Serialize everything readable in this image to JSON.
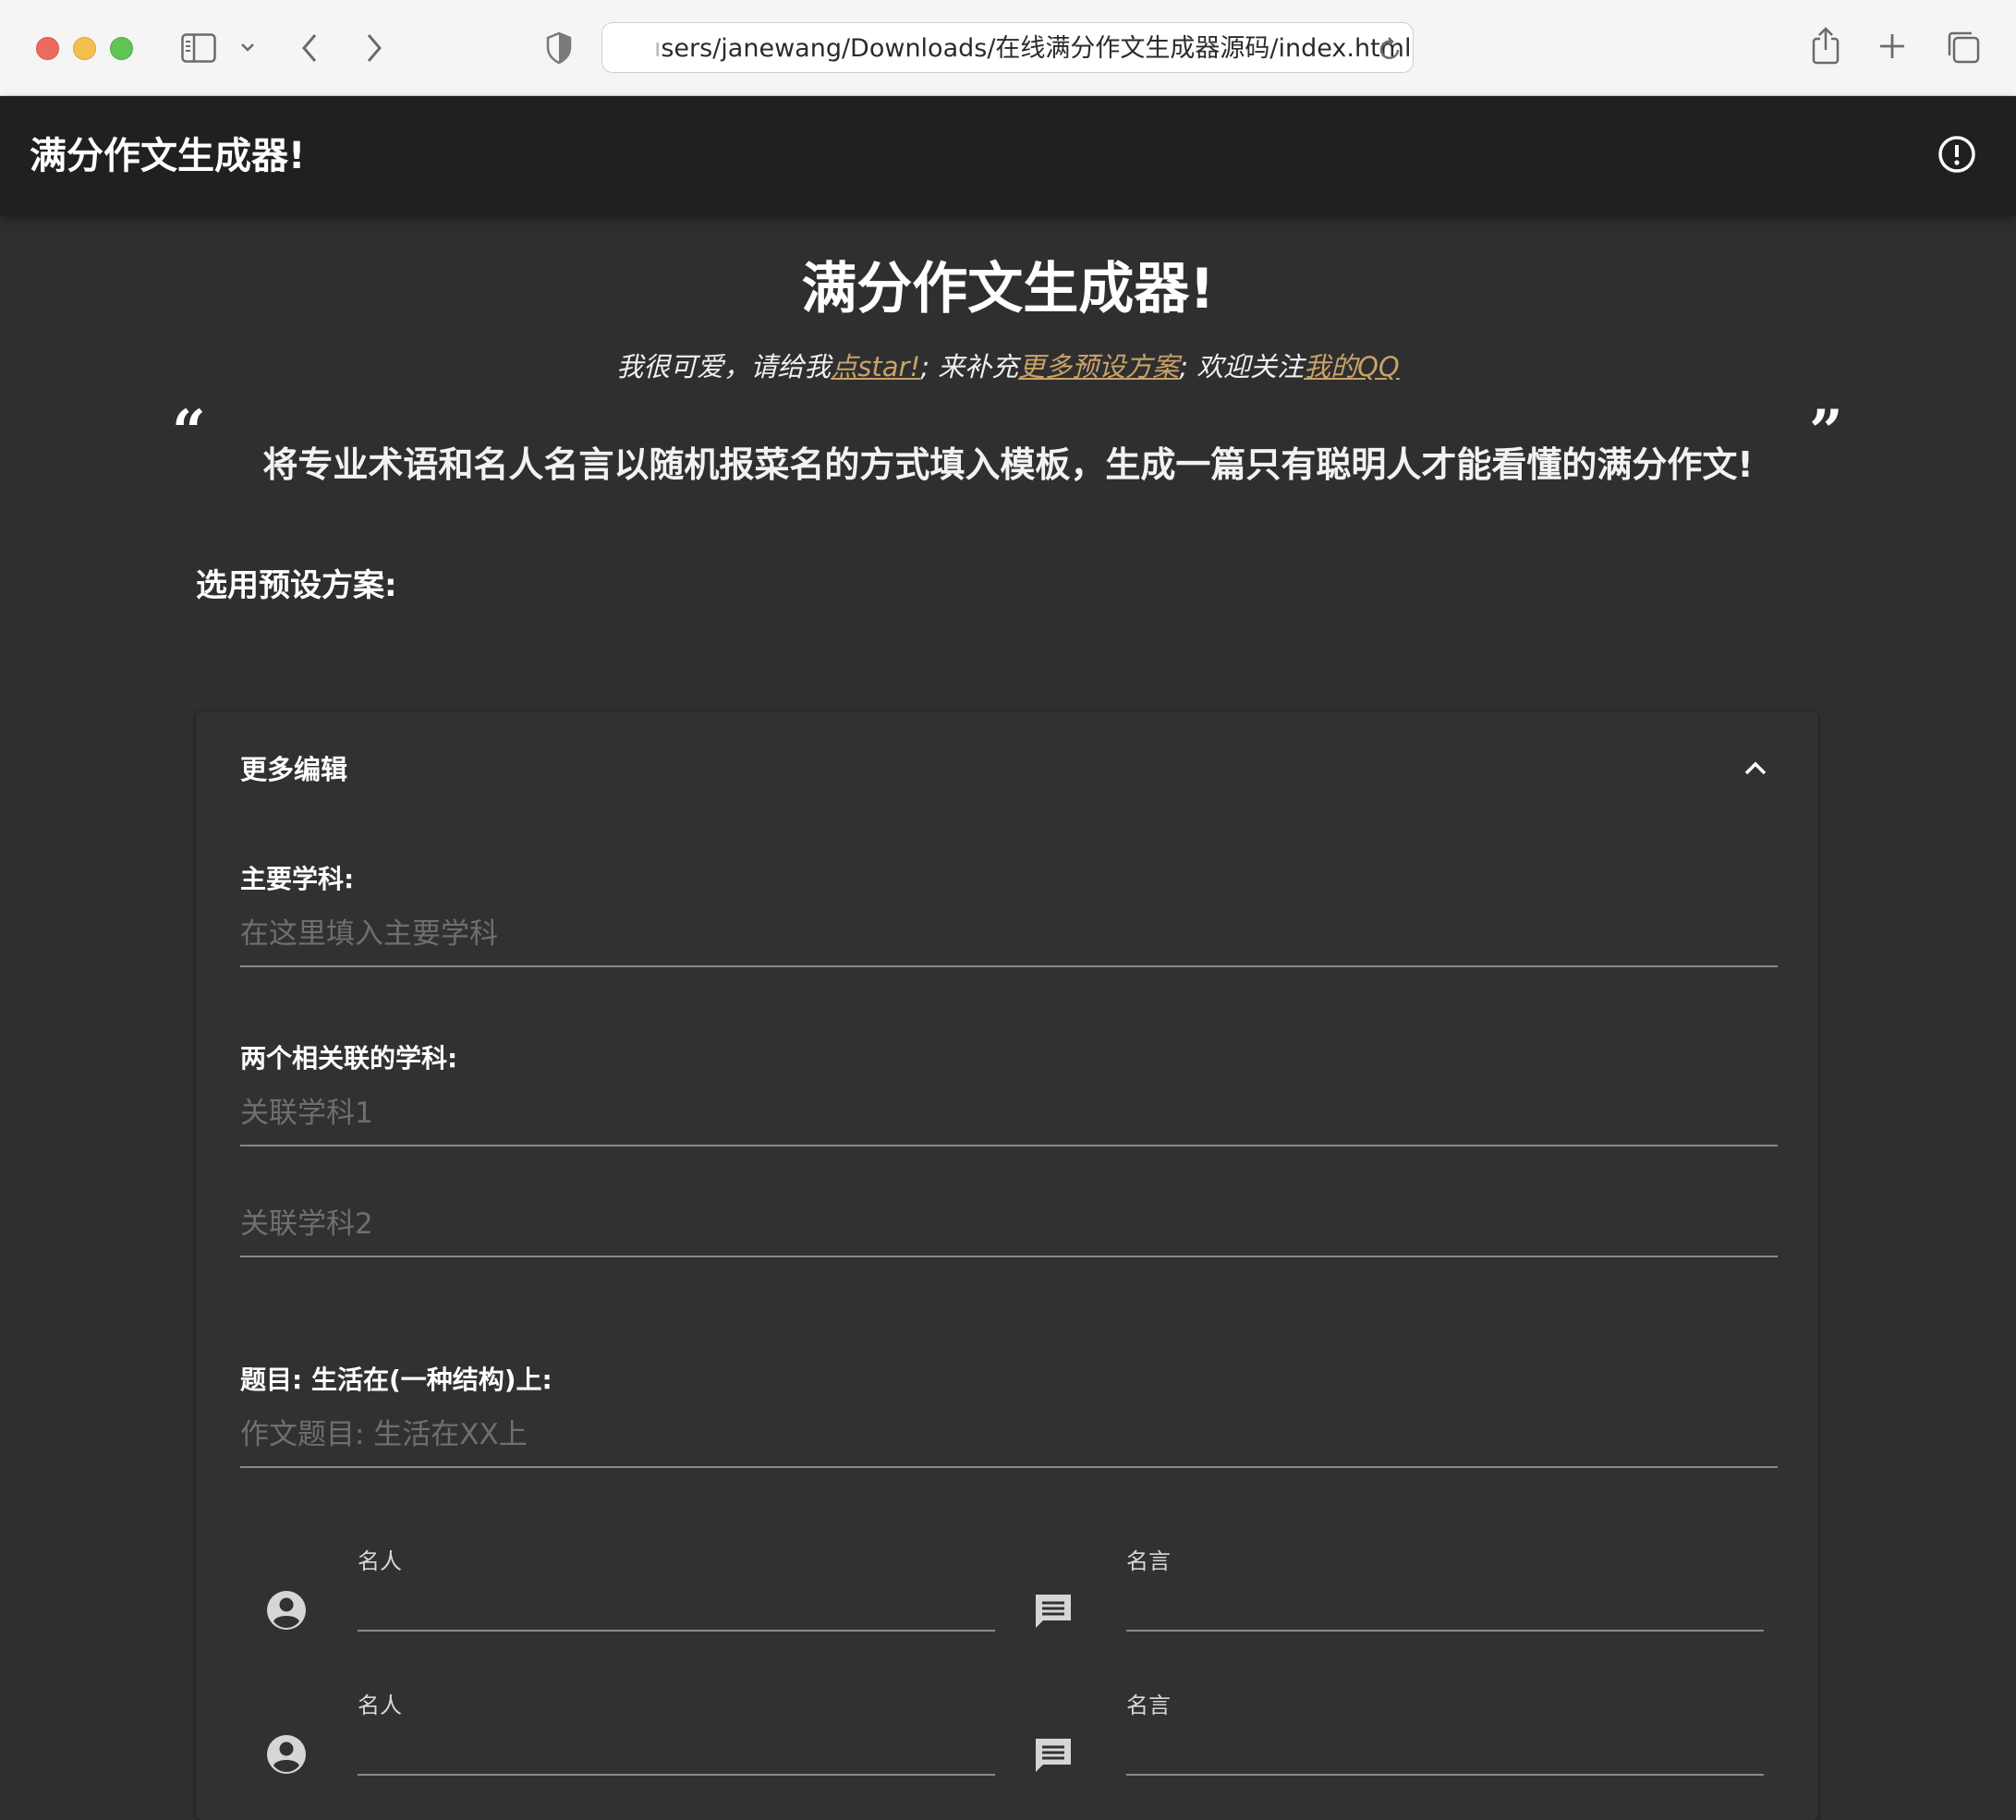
{
  "browser": {
    "url_faded": "ו",
    "url_main": "sers/janewang/Downloads/在线满分作文生成器源码/index.html"
  },
  "appbar": {
    "title": "满分作文生成器!"
  },
  "hero": {
    "title": "满分作文生成器!",
    "sub_part1": "我很可爱，请给我",
    "sub_link1": "点star!",
    "sub_part2": "; 来补充",
    "sub_link2": "更多预设方案",
    "sub_part3": "; 欢迎关注",
    "sub_link3": "我的QQ",
    "quote_open": "“",
    "quote": "将专业术语和名人名言以随机报菜名的方式填入模板，生成一篇只有聪明人才能看懂的满分作文!",
    "quote_close": "”"
  },
  "preset": {
    "label": "选用预设方案:"
  },
  "panel": {
    "header": "更多编辑",
    "main_subject_label": "主要学科:",
    "main_subject_placeholder": "在这里填入主要学科",
    "related_label": "两个相关联的学科:",
    "related1_placeholder": "关联学科1",
    "related2_placeholder": "关联学科2",
    "topic_label": "题目: 生活在(一种结构)上:",
    "topic_placeholder": "作文题目: 生活在XX上",
    "quote_rows": [
      {
        "person_label": "名人",
        "quote_label": "名言"
      },
      {
        "person_label": "名人",
        "quote_label": "名言"
      }
    ]
  },
  "colors": {
    "accent_link": "#c9a26a",
    "appbar_bg": "#202022",
    "page_bg": "#2f2f30"
  }
}
